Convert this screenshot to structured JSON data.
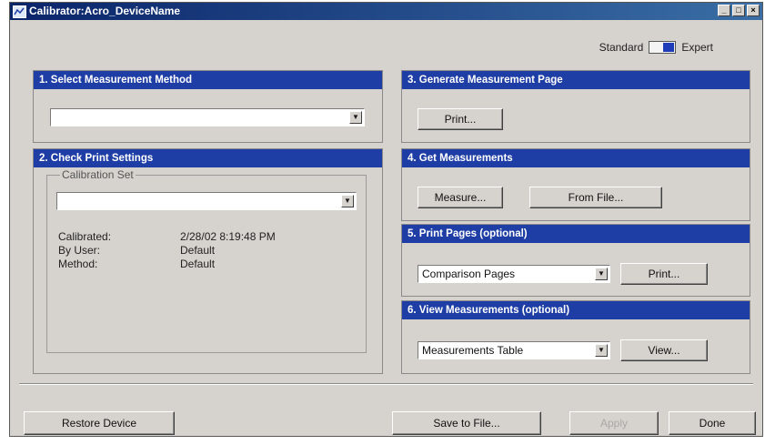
{
  "window": {
    "title": "Calibrator:Acro_DeviceName"
  },
  "mode": {
    "standard_label": "Standard",
    "expert_label": "Expert"
  },
  "panels": {
    "select_method": {
      "header": "1. Select Measurement Method",
      "value": ""
    },
    "print_settings": {
      "header": "2. Check Print Settings",
      "group_label": "Calibration Set",
      "value": "",
      "calibrated_label": "Calibrated:",
      "calibrated_value": "2/28/02 8:19:48 PM",
      "by_user_label": "By User:",
      "by_user_value": "Default",
      "method_label": "Method:",
      "method_value": "Default"
    },
    "generate_page": {
      "header": "3. Generate Measurement Page",
      "print_label": "Print..."
    },
    "get_measurements": {
      "header": "4. Get Measurements",
      "measure_label": "Measure...",
      "from_file_label": "From File..."
    },
    "print_pages": {
      "header": "5. Print Pages (optional)",
      "select_value": "Comparison Pages",
      "print_label": "Print..."
    },
    "view_measurements": {
      "header": "6. View Measurements (optional)",
      "select_value": "Measurements Table",
      "view_label": "View..."
    }
  },
  "footer": {
    "restore_label": "Restore Device",
    "save_label": "Save to File...",
    "apply_label": "Apply",
    "done_label": "Done"
  }
}
